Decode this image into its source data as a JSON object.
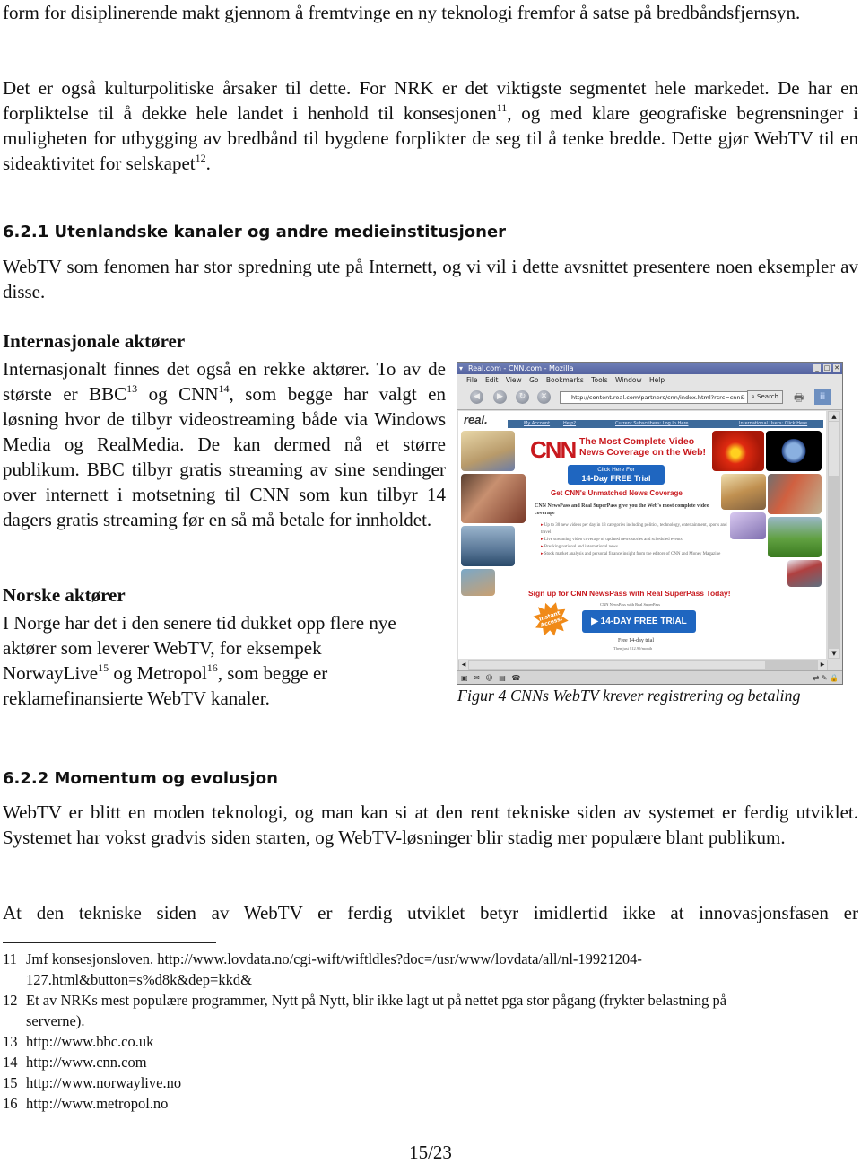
{
  "paragraphs": {
    "p0": "form for disiplinerende makt gjennom å fremtvinge en ny teknologi fremfor å satse på bredbåndsfjernsyn.",
    "p1_a": "Det er også kulturpolitiske årsaker til dette. For NRK er det viktigste segmentet hele markedet. De har en forpliktelse til å dekke hele landet i henhold til konsesjonen",
    "p1_fn1": "11",
    "p1_b": ", og med klare geografiske begrensninger i muligheten for utbygging av bredbånd til bygdene forplikter de seg til å tenke bredde. Dette gjør WebTV til en sideaktivitet for selskapet",
    "p1_fn2": "12",
    "p1_c": "."
  },
  "section_621": {
    "heading": "6.2.1 Utenlandske kanaler og andre medieinstitusjoner",
    "intro": "WebTV som fenomen har stor spredning ute på Internett, og vi vil i dette avsnittet presentere noen eksempler av disse.",
    "international": {
      "heading": "Internasjonale aktører",
      "text_a": "Internasjonalt finnes det også en rekke aktører. To av de største er BBC",
      "fn_bbc": "13",
      "text_b": " og CNN",
      "fn_cnn": "14",
      "text_c": ", som begge har valgt en løsning hvor de tilbyr videostreaming både via Windows Media og RealMedia. De kan dermed nå et større publikum. BBC tilbyr gratis streaming av sine sendinger over internett i motsetning til CNN som kun tilbyr 14 dagers gratis streaming før en så må betale for innholdet."
    },
    "norwegian": {
      "heading": "Norske aktører",
      "line1": "I Norge har det i den senere tid dukket opp flere nye",
      "line2": "aktører som leverer WebTV, for eksempek",
      "line3_a": "NorwayLive",
      "fn_nl": "15",
      "line3_b": " og Metropol",
      "fn_mp": "16",
      "line3_c": ", som begge er",
      "line4": "reklamefinansierte WebTV kanaler."
    }
  },
  "figure": {
    "caption": "Figur 4 CNNs WebTV krever registrering og betaling",
    "browser": {
      "title": "Real.com - CNN.com - Mozilla",
      "menu": [
        "File",
        "Edit",
        "View",
        "Go",
        "Bookmarks",
        "Tools",
        "Window",
        "Help"
      ],
      "url": "http://content.real.com/partners/cnn/index.html?rsrc=cnn&",
      "search_label": "Search",
      "icons": {
        "back": "◀",
        "forward": "▶",
        "reload": "↻",
        "stop": "✕"
      }
    },
    "page": {
      "logo": "real.",
      "nav": [
        "My Account",
        "Help?",
        "Current Subscribers: Log In Here",
        "International Users: Click Here"
      ],
      "cnn_logo": "CNN",
      "tagline_1": "The Most Complete Video",
      "tagline_2": "News Coverage on the Web!",
      "cta1_small": "Click Here For",
      "cta1_big": "14-Day FREE Trial",
      "unmatched": "Get CNN's Unmatched News Coverage",
      "intro": "CNN NewsPass and Real SuperPass give you the Web's most complete video coverage",
      "bullets": [
        "Up to 30 new videos per day in 13 categories including politics, technology, entertainment, sports and travel",
        "Live streaming video coverage of updated news stories and scheduled events",
        "Breaking national and international news",
        "Stock market analysis and personal finance insight from the editors of CNN and Money Magazine"
      ],
      "signup": "Sign up for CNN NewsPass with Real SuperPass Today!",
      "burst": "Instant Access!",
      "np_label": "CNN NewsPass with Real SuperPass",
      "cta2": "▶ 14-DAY FREE TRIAL",
      "free": "Free 14-day trial",
      "price": "Then just $12.99/month"
    },
    "colors": {
      "cnn_red": "#c8191e",
      "button_blue": "#1f66c0",
      "nav_blue": "#3d6a9a",
      "burst_orange": "#f08a18"
    }
  },
  "section_622": {
    "heading": "6.2.2 Momentum og evolusjon",
    "p1": "WebTV er blitt en moden teknologi, og man kan si at den rent tekniske siden av systemet er ferdig utviklet. Systemet har vokst gradvis siden starten, og WebTV-løsninger blir stadig mer populære blant publikum.",
    "p2": "At den tekniske siden av WebTV er ferdig utviklet betyr imidlertid ikke at innovasjonsfasen er"
  },
  "footnotes": [
    {
      "num": "11",
      "line1": "Jmf konsesjonsloven. http://www.lovdata.no/cgi-wift/wiftldles?doc=/usr/www/lovdata/all/nl-19921204-",
      "line2": "127.html&button=s%d8k&dep=kkd&"
    },
    {
      "num": "12",
      "line1": "Et av NRKs mest populære programmer, Nytt på Nytt, blir ikke lagt ut på nettet pga stor pågang (frykter belastning på",
      "line2": "serverne)."
    },
    {
      "num": "13",
      "line1": "http://www.bbc.co.uk"
    },
    {
      "num": "14",
      "line1": "http://www.cnn.com"
    },
    {
      "num": "15",
      "line1": "http://www.norwaylive.no"
    },
    {
      "num": "16",
      "line1": "http://www.metropol.no"
    }
  ],
  "page_number": "15/23"
}
